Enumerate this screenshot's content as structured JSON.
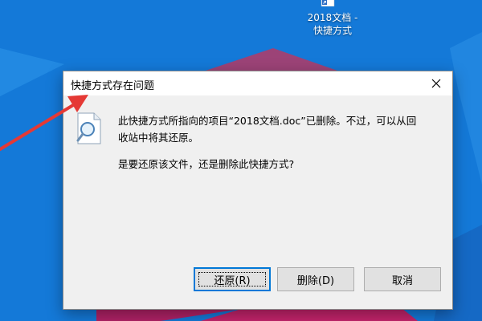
{
  "desktop": {
    "icon_label_line1": "2018文档 -",
    "icon_label_line2": "快捷方式"
  },
  "dialog": {
    "title": "快捷方式存在问题",
    "message_line1": "此快捷方式所指向的项目“2018文档.doc”已删除。不过，可以从回",
    "message_line2": "收站中将其还原。",
    "question": "是要还原该文件，还是删除此快捷方式?",
    "buttons": {
      "restore": "还原(R)",
      "delete": "删除(D)",
      "cancel": "取消"
    }
  },
  "colors": {
    "desktop_blue": "#1e88e5",
    "annotation_arrow": "#e53935",
    "default_button_border": "#0078d7"
  }
}
